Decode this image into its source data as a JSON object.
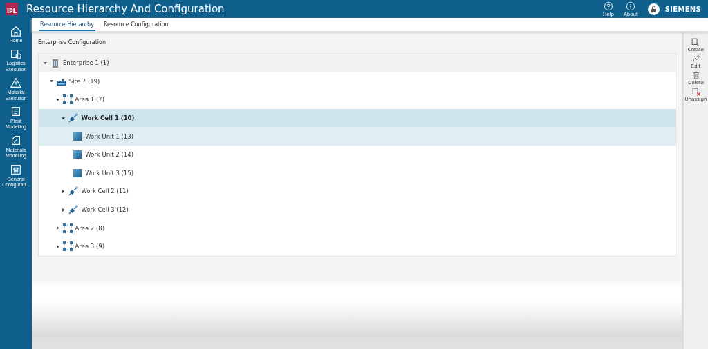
{
  "app": {
    "logo": "IPL",
    "title": "Resource Hierarchy And Configuration",
    "help": "Help",
    "about": "About",
    "brand": "SIEMENS"
  },
  "tabs": [
    {
      "label": "Resource Hierarchy",
      "selected": true
    },
    {
      "label": "Resource Configuration",
      "selected": false
    }
  ],
  "sidebar": {
    "items": [
      {
        "label": "Home"
      },
      {
        "label": "Logistics Execution"
      },
      {
        "label": "Material Execution"
      },
      {
        "label": "Plant Modelling"
      },
      {
        "label": "Materials Modelling"
      },
      {
        "label": "General Configurati..."
      }
    ]
  },
  "panel": {
    "title": "Enterprise Configuration",
    "tree": [
      {
        "kind": "enterprise",
        "label": "Enterprise 1 (1)",
        "expanded": true,
        "selected": false,
        "highlighted": false,
        "children": [
          {
            "kind": "site",
            "label": "Site 7 (19)",
            "expanded": true,
            "selected": false,
            "highlighted": false,
            "children": [
              {
                "kind": "area",
                "label": "Area 1 (7)",
                "expanded": true,
                "selected": false,
                "highlighted": false,
                "children": [
                  {
                    "kind": "cell",
                    "label": "Work Cell 1 (10)",
                    "expanded": true,
                    "selected": true,
                    "highlighted": false,
                    "children": [
                      {
                        "kind": "unit",
                        "label": "Work Unit 1 (13)",
                        "selected": false,
                        "highlighted": true
                      },
                      {
                        "kind": "unit",
                        "label": "Work Unit 2 (14)",
                        "selected": false,
                        "highlighted": false
                      },
                      {
                        "kind": "unit",
                        "label": "Work Unit 3 (15)",
                        "selected": false,
                        "highlighted": false
                      }
                    ]
                  },
                  {
                    "kind": "cell",
                    "label": "Work Cell 2 (11)",
                    "expanded": false,
                    "selected": false,
                    "highlighted": false
                  },
                  {
                    "kind": "cell",
                    "label": "Work Cell 3 (12)",
                    "expanded": false,
                    "selected": false,
                    "highlighted": false
                  }
                ]
              },
              {
                "kind": "area",
                "label": "Area 2 (8)",
                "expanded": false,
                "selected": false,
                "highlighted": false
              },
              {
                "kind": "area",
                "label": "Area 3 (9)",
                "expanded": false,
                "selected": false,
                "highlighted": false
              }
            ]
          }
        ]
      }
    ]
  },
  "actions": [
    {
      "label": "Create"
    },
    {
      "label": "Edit"
    },
    {
      "label": "Delete"
    },
    {
      "label": "Unassign"
    }
  ]
}
